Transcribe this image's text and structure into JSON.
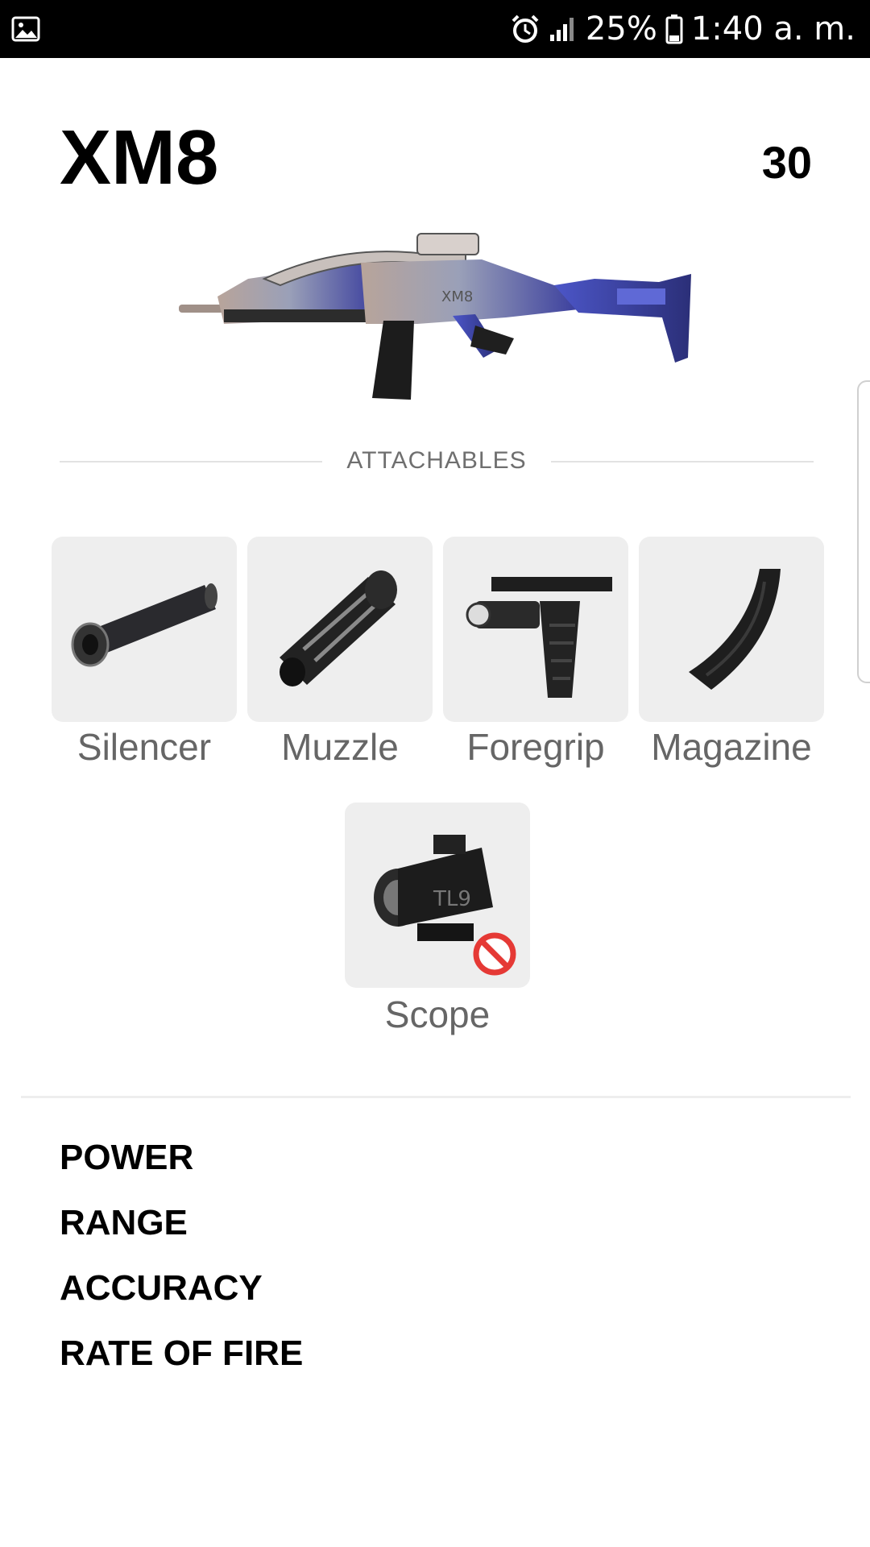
{
  "status_bar": {
    "battery": "25%",
    "time": "1:40 a. m."
  },
  "weapon": {
    "name": "XM8",
    "count": "30",
    "engraving": "XM8",
    "icon": "assault-rifle-image"
  },
  "attachables": {
    "section_label": "ATTACHABLES",
    "items": [
      {
        "label": "Silencer",
        "icon": "silencer-image"
      },
      {
        "label": "Muzzle",
        "icon": "muzzle-image"
      },
      {
        "label": "Foregrip",
        "icon": "foregrip-image"
      },
      {
        "label": "Magazine",
        "icon": "magazine-image"
      },
      {
        "label": "Scope",
        "icon": "scope-image",
        "unavailable": true
      }
    ]
  },
  "stats": [
    "POWER",
    "RANGE",
    "ACCURACY",
    "RATE OF FIRE"
  ],
  "colors": {
    "tile_bg": "#eeeeee",
    "label_gray": "#666666",
    "prohibited_red": "#e53935",
    "status_bar": "#000000"
  }
}
